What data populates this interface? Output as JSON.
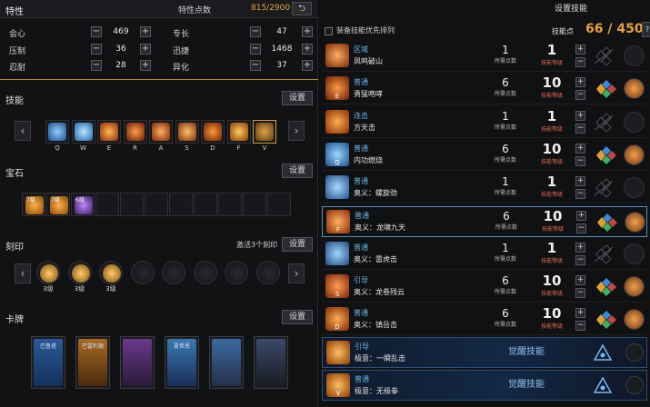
{
  "stats": {
    "title": "特性",
    "points_label": "特性点数",
    "points_value": "815/2900",
    "items": [
      {
        "name": "会心",
        "value": "469"
      },
      {
        "name": "压制",
        "value": "36"
      },
      {
        "name": "忍耐",
        "value": "28"
      },
      {
        "name": "专长",
        "value": "47"
      },
      {
        "name": "迅捷",
        "value": "1468"
      },
      {
        "name": "异化",
        "value": "37"
      }
    ]
  },
  "skills_section": {
    "title": "技能",
    "button": "设置",
    "keys": [
      "Q",
      "W",
      "E",
      "R",
      "A",
      "S",
      "D",
      "F",
      "V"
    ]
  },
  "gems_section": {
    "title": "宝石",
    "button": "设置",
    "gems": [
      "7级",
      "7级",
      "6级"
    ]
  },
  "engraving_section": {
    "title": "刻印",
    "hint": "激活3个刻印",
    "button": "设置",
    "levels": [
      "3级",
      "3级",
      "3级"
    ]
  },
  "cards_section": {
    "title": "卡牌",
    "button": "设置",
    "cards": [
      "巴鲁塔",
      "巴雷利德",
      "",
      "夏希恩",
      "",
      ""
    ]
  },
  "right": {
    "title": "设置技能",
    "priority_label": "装备技能优先排列",
    "skill_points_label": "技能点",
    "skill_points_value": "66 / 450",
    "req_label": "所需点数",
    "lvl_label": "技能等级",
    "rows": [
      {
        "key": "",
        "type": "区域",
        "name": "凤鸣破山",
        "req": "1",
        "lvl": "1",
        "runes": false
      },
      {
        "key": "E",
        "type": "普通",
        "name": "勇猛咆哮",
        "req": "6",
        "lvl": "10",
        "runes": true
      },
      {
        "key": "",
        "type": "连击",
        "name": "方天击",
        "req": "1",
        "lvl": "1",
        "runes": false
      },
      {
        "key": "Q",
        "type": "普通",
        "name": "内功燃烧",
        "req": "6",
        "lvl": "10",
        "runes": true
      },
      {
        "key": "",
        "type": "普通",
        "name": "奥义：螺旋劲",
        "req": "1",
        "lvl": "1",
        "runes": false
      },
      {
        "key": "F",
        "type": "普通",
        "name": "奥义：龙啸九天",
        "req": "6",
        "lvl": "10",
        "runes": true
      },
      {
        "key": "",
        "type": "普通",
        "name": "奥义：雷虎击",
        "req": "1",
        "lvl": "1",
        "runes": false
      },
      {
        "key": "S",
        "type": "引导",
        "name": "奥义：龙卷残云",
        "req": "6",
        "lvl": "10",
        "runes": true
      },
      {
        "key": "D",
        "type": "普通",
        "name": "奥义：镇岳击",
        "req": "6",
        "lvl": "10",
        "runes": true
      }
    ],
    "awaken_rows": [
      {
        "key": "",
        "type": "引导",
        "name": "极意：一瞬乱击",
        "label": "觉醒技能"
      },
      {
        "key": "V",
        "type": "普通",
        "name": "极意：无极拳",
        "label": "觉醒技能"
      }
    ]
  }
}
